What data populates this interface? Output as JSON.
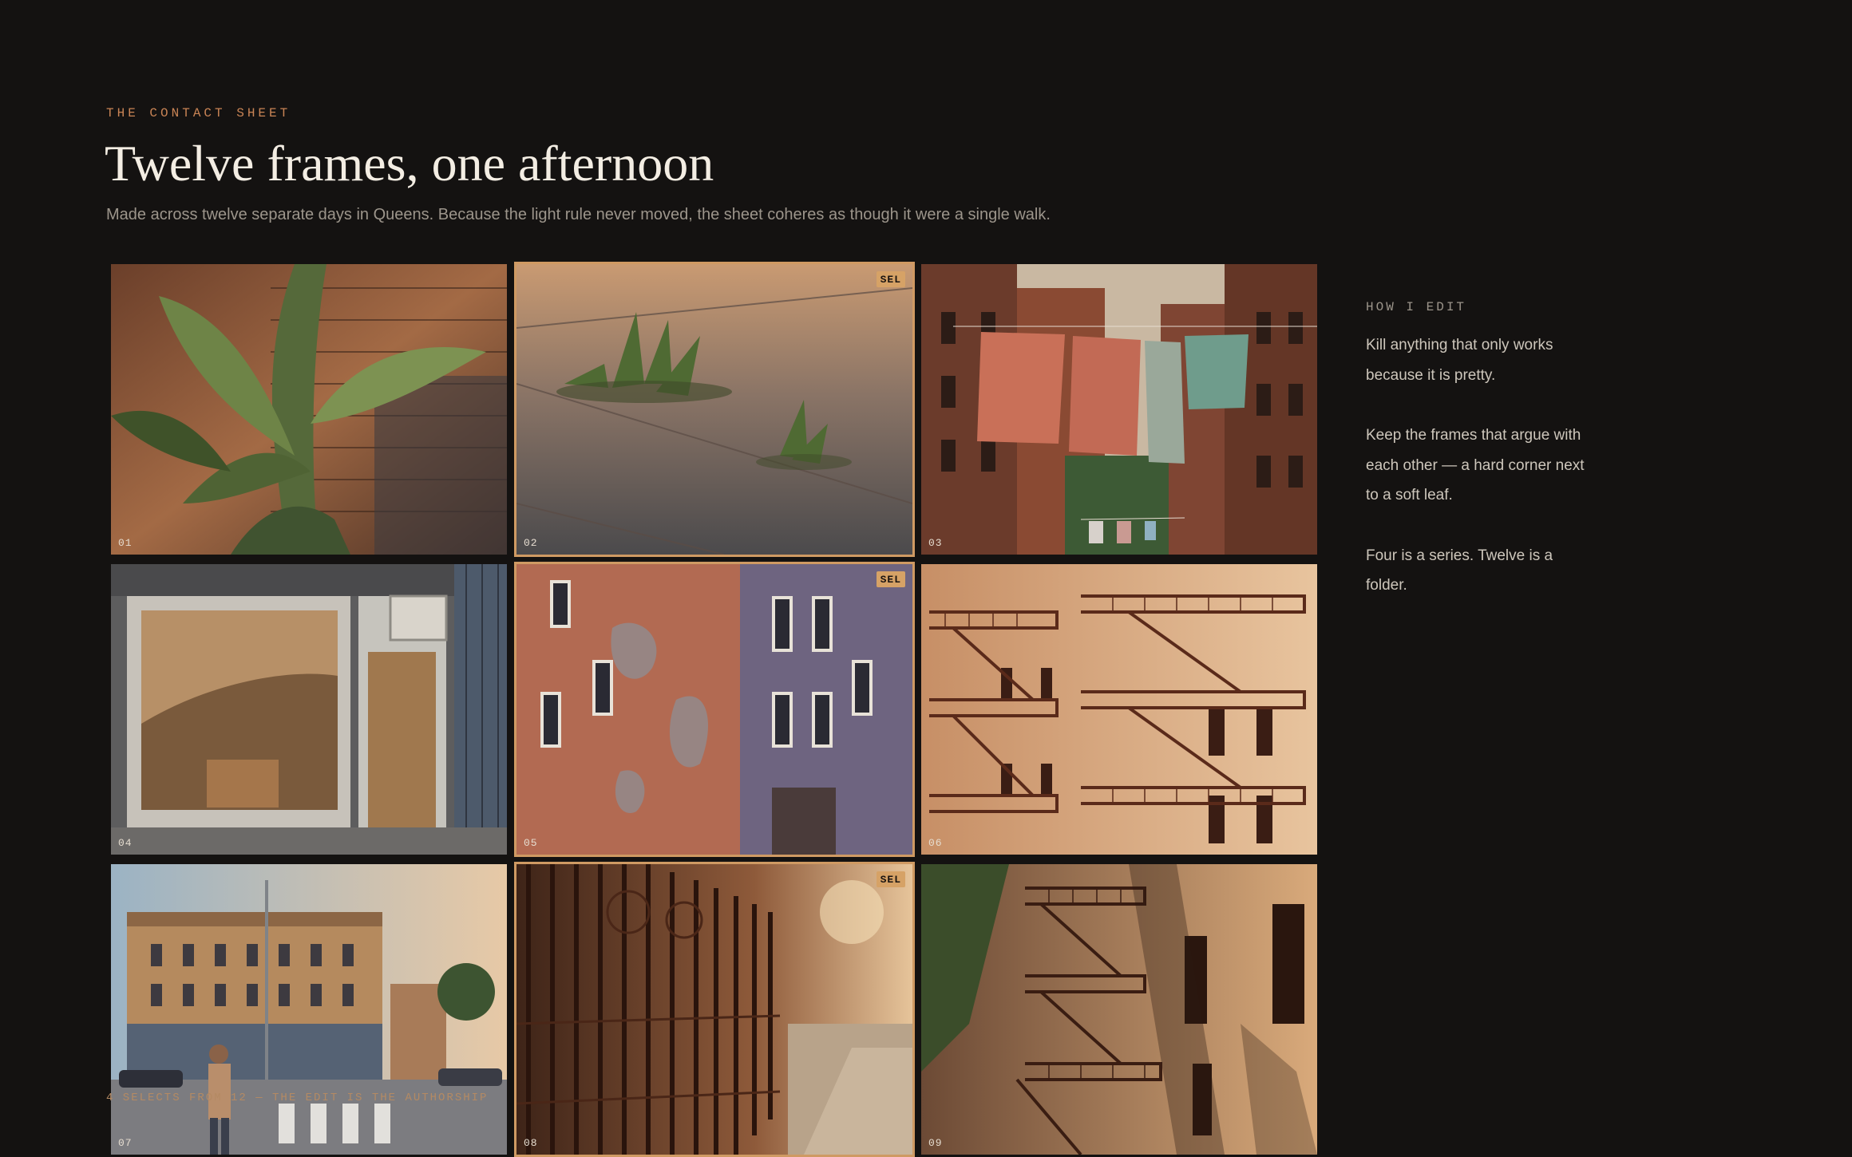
{
  "header": {
    "eyebrow": "THE CONTACT SHEET",
    "title": "Twelve frames, one afternoon",
    "subtitle": "Made across twelve separate days in Queens. Because the light rule never moved, the sheet coheres as though it were a single walk."
  },
  "frames": [
    {
      "number": "01",
      "selected": false,
      "subject": "banana leaf against brick wall"
    },
    {
      "number": "02",
      "selected": true,
      "badge": "SEL",
      "subject": "weeds in pavement crack"
    },
    {
      "number": "03",
      "selected": false,
      "subject": "laundry line between buildings"
    },
    {
      "number": "04",
      "selected": false,
      "subject": "shop window with air conditioner"
    },
    {
      "number": "05",
      "selected": true,
      "badge": "SEL",
      "subject": "peeling painted facade"
    },
    {
      "number": "06",
      "selected": false,
      "subject": "fire escapes in sunlight"
    },
    {
      "number": "07",
      "selected": false,
      "subject": "street corner with pedestrian"
    },
    {
      "number": "08",
      "selected": true,
      "badge": "SEL",
      "subject": "wrought iron fence"
    },
    {
      "number": "09",
      "selected": false,
      "subject": "fire escape with tree shadows"
    }
  ],
  "sidebar": {
    "heading": "HOW I EDIT",
    "paragraphs": [
      "Kill anything that only works because it is pretty.",
      "Keep the frames that argue with each other — a hard corner next to a soft leaf.",
      "Four is a series. Twelve is a folder."
    ]
  },
  "footer": {
    "note": "4 SELECTS FROM 12 — THE EDIT IS THE AUTHORSHIP"
  },
  "colors": {
    "background": "#141211",
    "accent": "#c98455",
    "select_outline": "#cf9a63"
  }
}
